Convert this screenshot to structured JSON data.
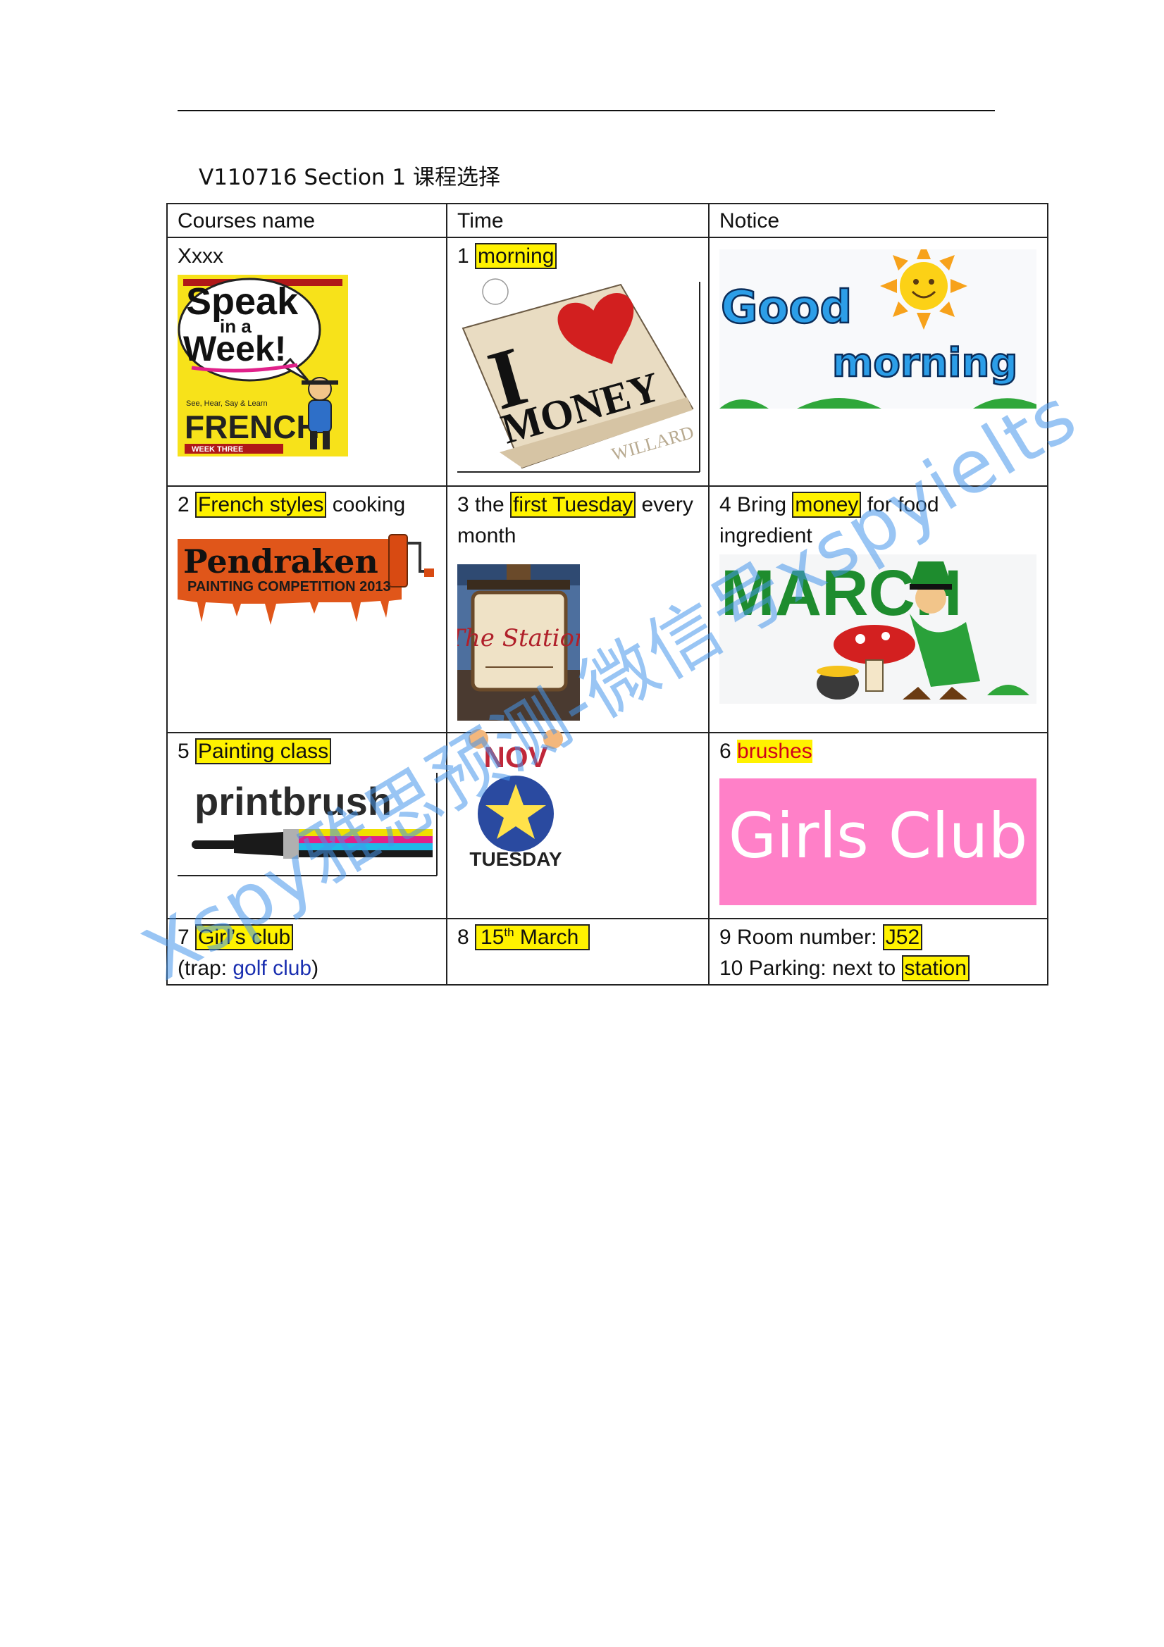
{
  "document": {
    "title": "V110716 Section 1  课程选择",
    "watermark": "Xspy雅思预测-微信号xspyielts"
  },
  "table": {
    "headers": [
      "Courses name",
      "Time",
      "Notice"
    ],
    "row1": {
      "c1_text": "Xxxx",
      "c2_num": "1 ",
      "c2_hl": "morning",
      "c3_text": ""
    },
    "row2": {
      "c1_num": "2 ",
      "c1_hl": "French styles",
      "c1_rest": " cooking",
      "c2_pre": "3 the ",
      "c2_hl": "first Tuesday",
      "c2_rest": " every month",
      "c3_pre": "4 Bring ",
      "c3_hl": "money",
      "c3_rest": " for food ingredient"
    },
    "row3": {
      "c1_num": "5 ",
      "c1_hl": "Painting class",
      "c2_text": "",
      "c3_num": "6 ",
      "c3_hl": "brushes"
    },
    "row4": {
      "c1_num": "7 ",
      "c1_hl": "Girl’s club",
      "c1_trap_pre": "(trap: ",
      "c1_trap": "golf club",
      "c1_trap_post": ")",
      "c2_num": "8 ",
      "c2_day": "15",
      "c2_sup": "th",
      "c2_month": " March",
      "c3_l1_pre": "9 Room number: ",
      "c3_l1_hl": "J52",
      "c3_l2_pre": "10 Parking: next to ",
      "c3_l2_hl": "station"
    }
  },
  "images": {
    "speak_week": {
      "line1": "Speak",
      "line2": "in a",
      "line3": "Week!",
      "sub": "See, Hear, Say & Learn",
      "lang": "FRENCH",
      "week": "WEEK THREE"
    },
    "money": {
      "big": "I",
      "word": "MONEY",
      "small": "WILLARD"
    },
    "good_morning": {
      "w1": "Good",
      "w2": "morning"
    },
    "pendraken": {
      "name": "Pendraken",
      "sub": "PAINTING COMPETITION 2013"
    },
    "station": {
      "sign": "The Station"
    },
    "march": {
      "word": "MARCH"
    },
    "printbrush": {
      "word": "printbrush"
    },
    "nov": {
      "month": "NOV",
      "day": "TUESDAY"
    },
    "girls_club": {
      "word": "Girls Club"
    }
  },
  "colors": {
    "highlight": "#fff200",
    "watermark": "#4696eb",
    "girls_club_bg": "#ff80c8",
    "march_green": "#1e8c2e"
  }
}
